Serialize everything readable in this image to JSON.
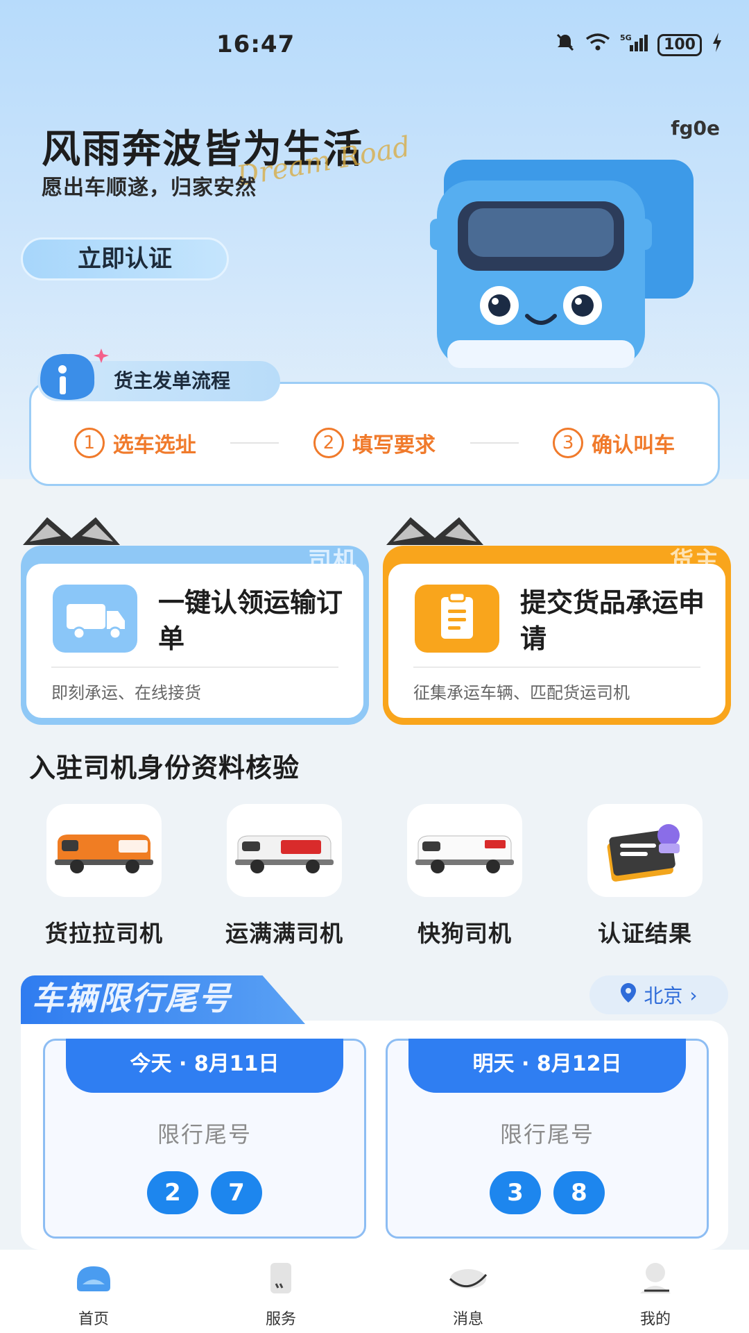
{
  "status_bar": {
    "time": "16:47",
    "battery": "100"
  },
  "hero": {
    "title": "风雨奔波皆为生活",
    "subtitle": "愿出车顺遂，归家安然",
    "script_text": "Dream Road",
    "code": "fg0e",
    "certify_button": "立即认证"
  },
  "flow": {
    "tag": "货主发单流程",
    "steps": [
      {
        "num": "1",
        "label": "选车选址"
      },
      {
        "num": "2",
        "label": "填写要求"
      },
      {
        "num": "3",
        "label": "确认叫车"
      }
    ]
  },
  "roles": {
    "driver": {
      "badge": "司机",
      "title": "一键认领运输订单",
      "desc": "即刻承运、在线接货",
      "color": "#8fc8f6"
    },
    "owner": {
      "badge": "货主",
      "title": "提交货品承运申请",
      "desc": "征集承运车辆、匹配货运司机",
      "color": "#f9a51c"
    }
  },
  "verify_section": {
    "title": "入驻司机身份资料核验",
    "items": [
      {
        "label": "货拉拉司机",
        "icon": "orange-van-icon"
      },
      {
        "label": "运满满司机",
        "icon": "white-van-red-icon"
      },
      {
        "label": "快狗司机",
        "icon": "white-van-icon"
      },
      {
        "label": "认证结果",
        "icon": "certificate-stamp-icon"
      }
    ]
  },
  "restriction": {
    "title": "车辆限行尾号",
    "city": "北京",
    "days": [
      {
        "head": "今天 · 8月11日",
        "label": "限行尾号",
        "numbers": [
          "2",
          "7"
        ]
      },
      {
        "head": "明天 · 8月12日",
        "label": "限行尾号",
        "numbers": [
          "3",
          "8"
        ]
      }
    ]
  },
  "nav": [
    {
      "label": "首页",
      "icon": "home-icon"
    },
    {
      "label": "服务",
      "icon": "service-icon"
    },
    {
      "label": "消息",
      "icon": "message-icon"
    },
    {
      "label": "我的",
      "icon": "profile-icon"
    }
  ]
}
